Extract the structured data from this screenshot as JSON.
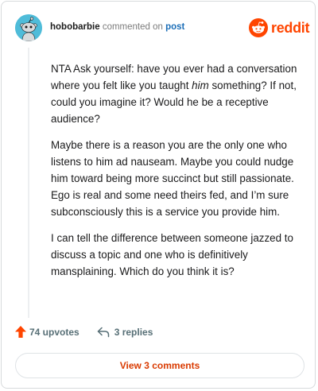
{
  "header": {
    "username": "hobobarbie",
    "action": "commented on",
    "post_link": "post",
    "brand": "reddit"
  },
  "comment": {
    "p1_before": "NTA Ask yourself: have you ever had a conversation where you felt like you taught ",
    "p1_emph": "him",
    "p1_after": " something? If not, could you imagine it? Would he be a receptive audience?",
    "p2": "Maybe there is a reason you are the only one who listens to him ad nauseam. Maybe you could nudge him toward being more succinct but still passionate. Ego is real and some need theirs fed, and I’m sure subconsciously this is a service you provide him.",
    "p3": "I can tell the difference between someone jazzed to discuss a topic and one who is definitively mansplaining. Which do you think it is?"
  },
  "footer": {
    "upvotes": "74 upvotes",
    "replies": "3 replies",
    "view_comments": "View 3 comments"
  },
  "colors": {
    "brand_orange": "#ff4500",
    "link_blue": "#1d6fb8",
    "avatar_bg": "#4fbcd9"
  },
  "icons": [
    "snoo-avatar-icon",
    "reddit-logo-icon",
    "upvote-arrow-icon",
    "reply-arrow-icon"
  ]
}
